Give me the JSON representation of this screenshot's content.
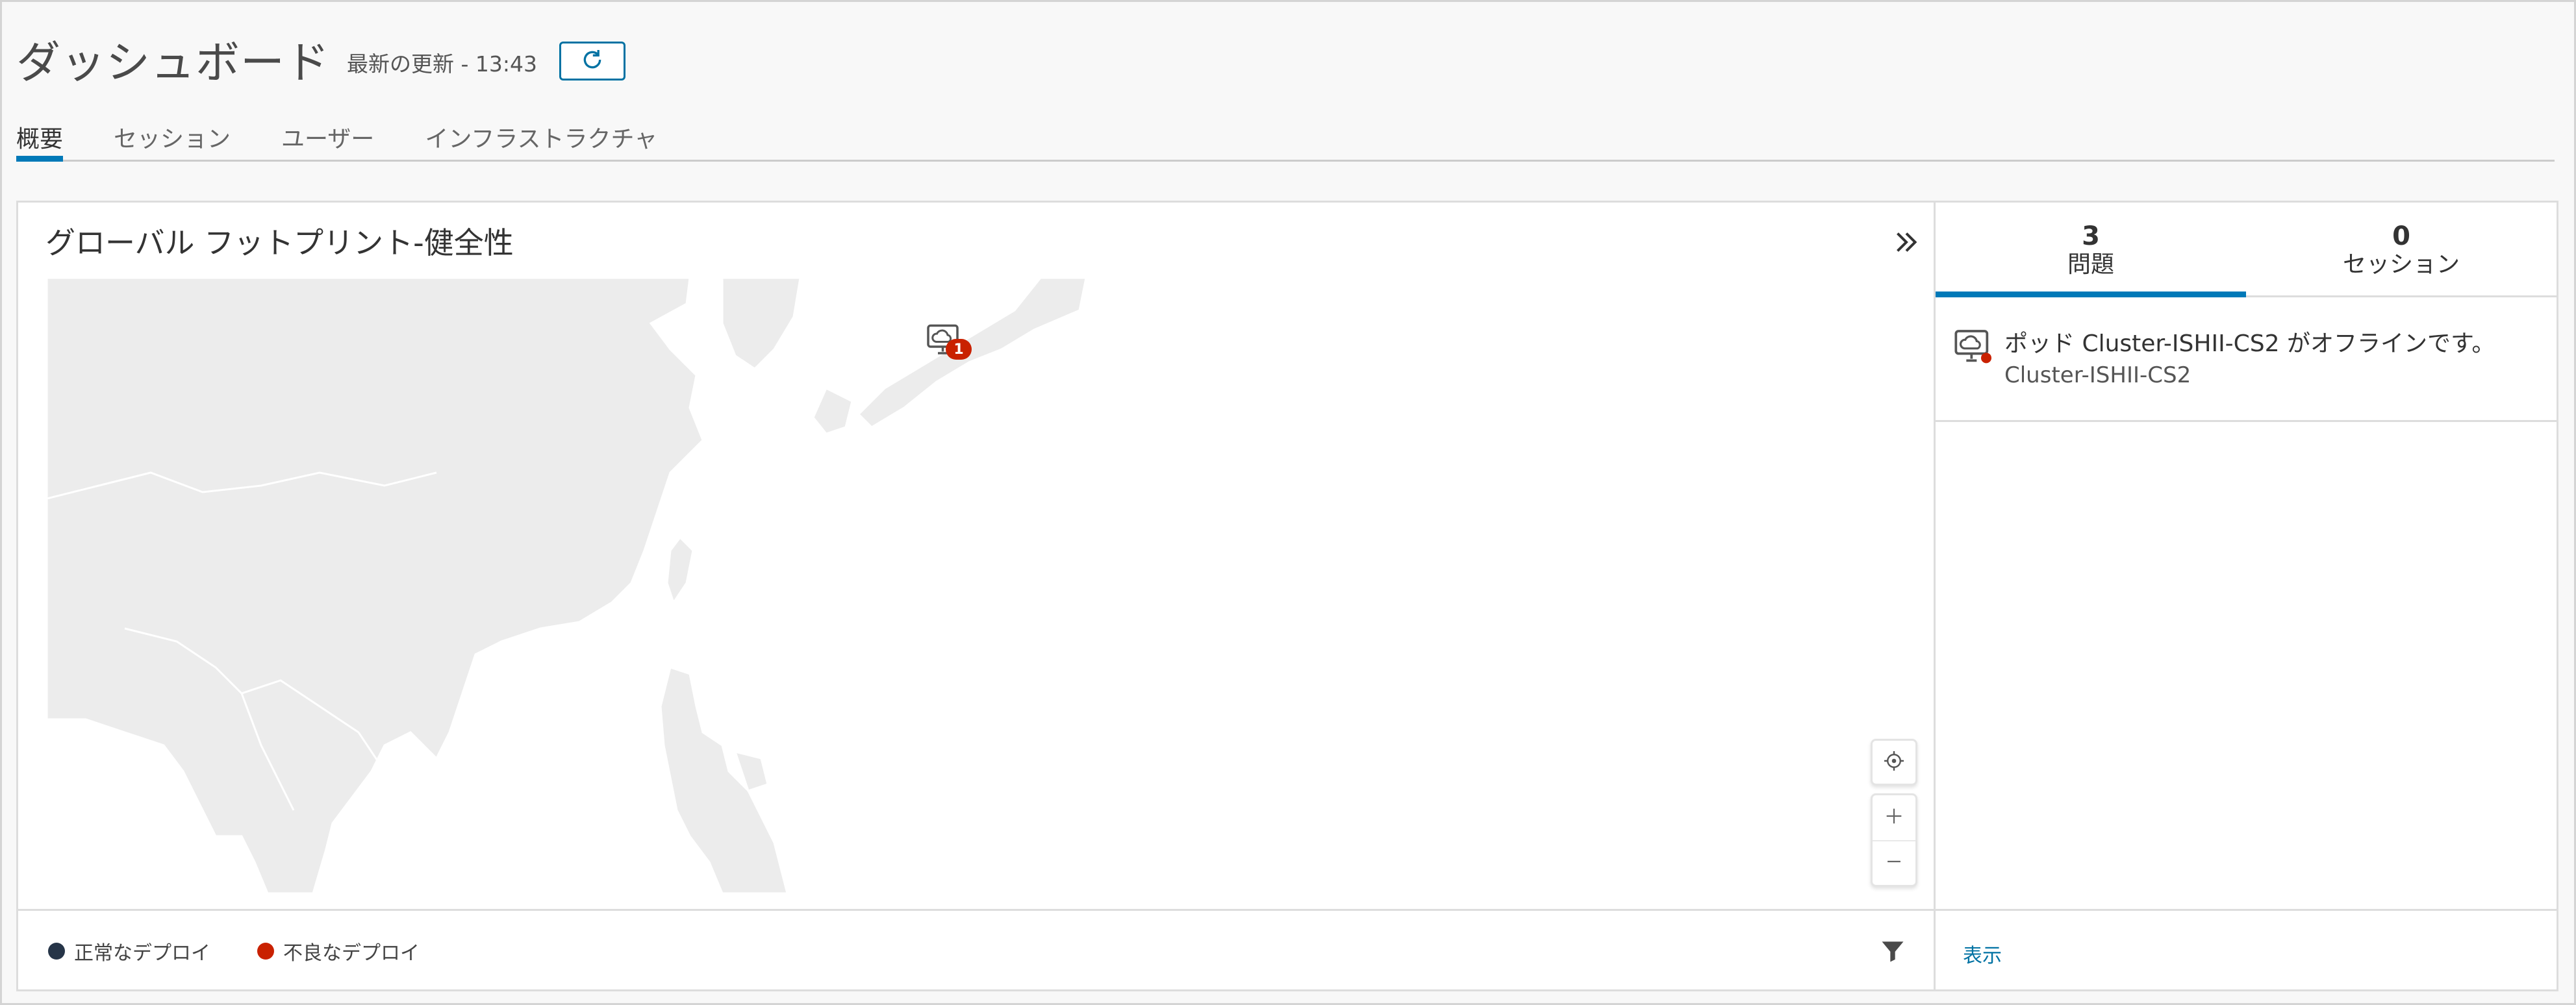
{
  "header": {
    "title": "ダッシュボード",
    "last_update": "最新の更新 - 13:43"
  },
  "tabs": [
    {
      "label": "概要",
      "active": true
    },
    {
      "label": "セッション",
      "active": false
    },
    {
      "label": "ユーザー",
      "active": false
    },
    {
      "label": "インフラストラクチャ",
      "active": false
    }
  ],
  "map": {
    "title": "グローバル フットプリント-健全性",
    "marker_count": "1"
  },
  "legend": {
    "healthy": "正常なデプロイ",
    "unhealthy": "不良なデプロイ",
    "healthy_color": "#263548",
    "unhealthy_color": "#c92100"
  },
  "side_tabs": [
    {
      "count": "3",
      "label": "問題",
      "active": true
    },
    {
      "count": "0",
      "label": "セッション",
      "active": false
    }
  ],
  "issues": [
    {
      "title": "ポッド Cluster-ISHII-CS2 がオフラインです。",
      "subtitle": "Cluster-ISHII-CS2"
    }
  ],
  "side_footer": {
    "view_label": "表示"
  },
  "icons": {
    "refresh": "refresh-icon",
    "collapse": "double-chevron-right-icon",
    "locate": "locate-icon",
    "zoom_in": "plus-icon",
    "zoom_out": "minus-icon",
    "filter": "filter-icon",
    "pod": "cloud-pod-icon"
  },
  "colors": {
    "accent": "#0079b8",
    "link": "#0072a3",
    "error": "#c92100",
    "land": "#ececec"
  }
}
